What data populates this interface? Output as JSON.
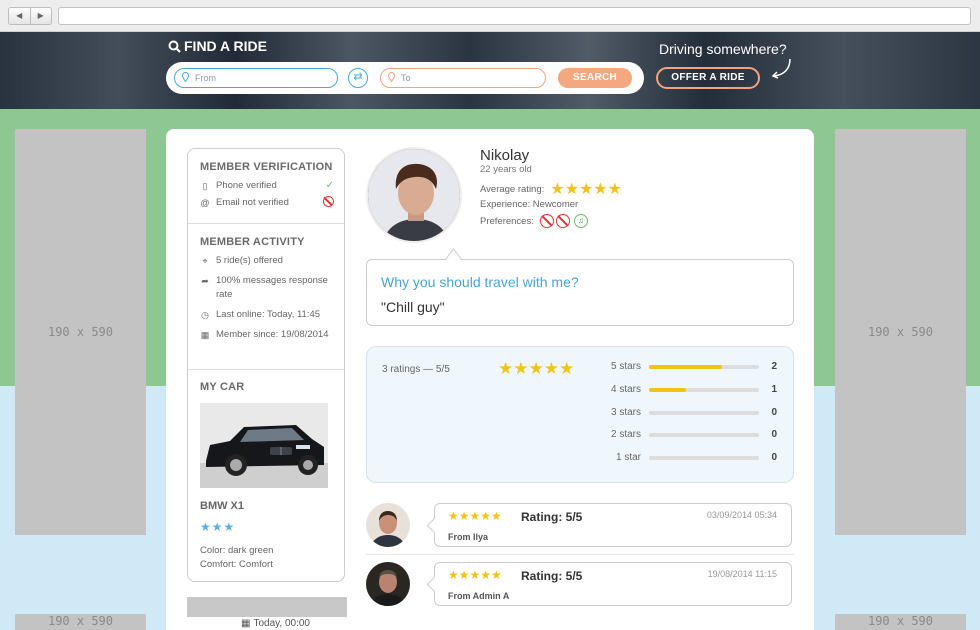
{
  "header": {
    "title": "FIND A RIDE",
    "from_placeholder": "From",
    "to_placeholder": "To",
    "search_label": "SEARCH",
    "driving_text": "Driving somewhere?",
    "offer_label": "OFFER A RIDE"
  },
  "ads": {
    "left": "190 x 590",
    "right": "190 x 590",
    "left_bottom": "190 x 590",
    "right_bottom": "190 x 590"
  },
  "sidebar": {
    "verification_title": "MEMBER VERIFICATION",
    "phone": "Phone verified",
    "email": "Email not verified",
    "activity_title": "MEMBER ACTIVITY",
    "rides": "5 ride(s) offered",
    "response": "100% messages response rate",
    "last_online": "Last online: Today, 11:45",
    "member_since": "Member since: 19/08/2014",
    "car_title": "MY CAR",
    "car_name": "BMW X1",
    "car_stars": "★★★",
    "color": "Color: dark green",
    "comfort": "Comfort: Comfort"
  },
  "footer_time": "Today, 00:00",
  "profile": {
    "name": "Nikolay",
    "age": "22 years old",
    "avg_label": "Average rating:",
    "avg_stars": "★★★★★",
    "experience": "Experience: Newcomer",
    "preferences_label": "Preferences:",
    "why_title": "Why you should travel with me?",
    "why_text": "\"Chill guy\""
  },
  "ratings": {
    "summary": "3 ratings — 5/5",
    "stars": "★★★★★",
    "rows": [
      {
        "label": "5 stars",
        "count": "2",
        "fraction": 0.667
      },
      {
        "label": "4 stars",
        "count": "1",
        "fraction": 0.333
      },
      {
        "label": "3 stars",
        "count": "0",
        "fraction": 0
      },
      {
        "label": "2 stars",
        "count": "0",
        "fraction": 0
      },
      {
        "label": "1 star",
        "count": "0",
        "fraction": 0
      }
    ]
  },
  "reviews": [
    {
      "stars": "★★★★★",
      "score": "Rating: 5/5",
      "date": "03/09/2014 05:34",
      "from": "From Ilya"
    },
    {
      "stars": "★★★★★",
      "score": "Rating: 5/5",
      "date": "19/08/2014 11:15",
      "from": "From Admin A"
    }
  ],
  "colors": {
    "accent_blue": "#4aa3d3",
    "accent_orange": "#f3a880",
    "star_gold": "#f2c218",
    "verified_green": "#6bbd6f",
    "error_red": "#e23333"
  }
}
